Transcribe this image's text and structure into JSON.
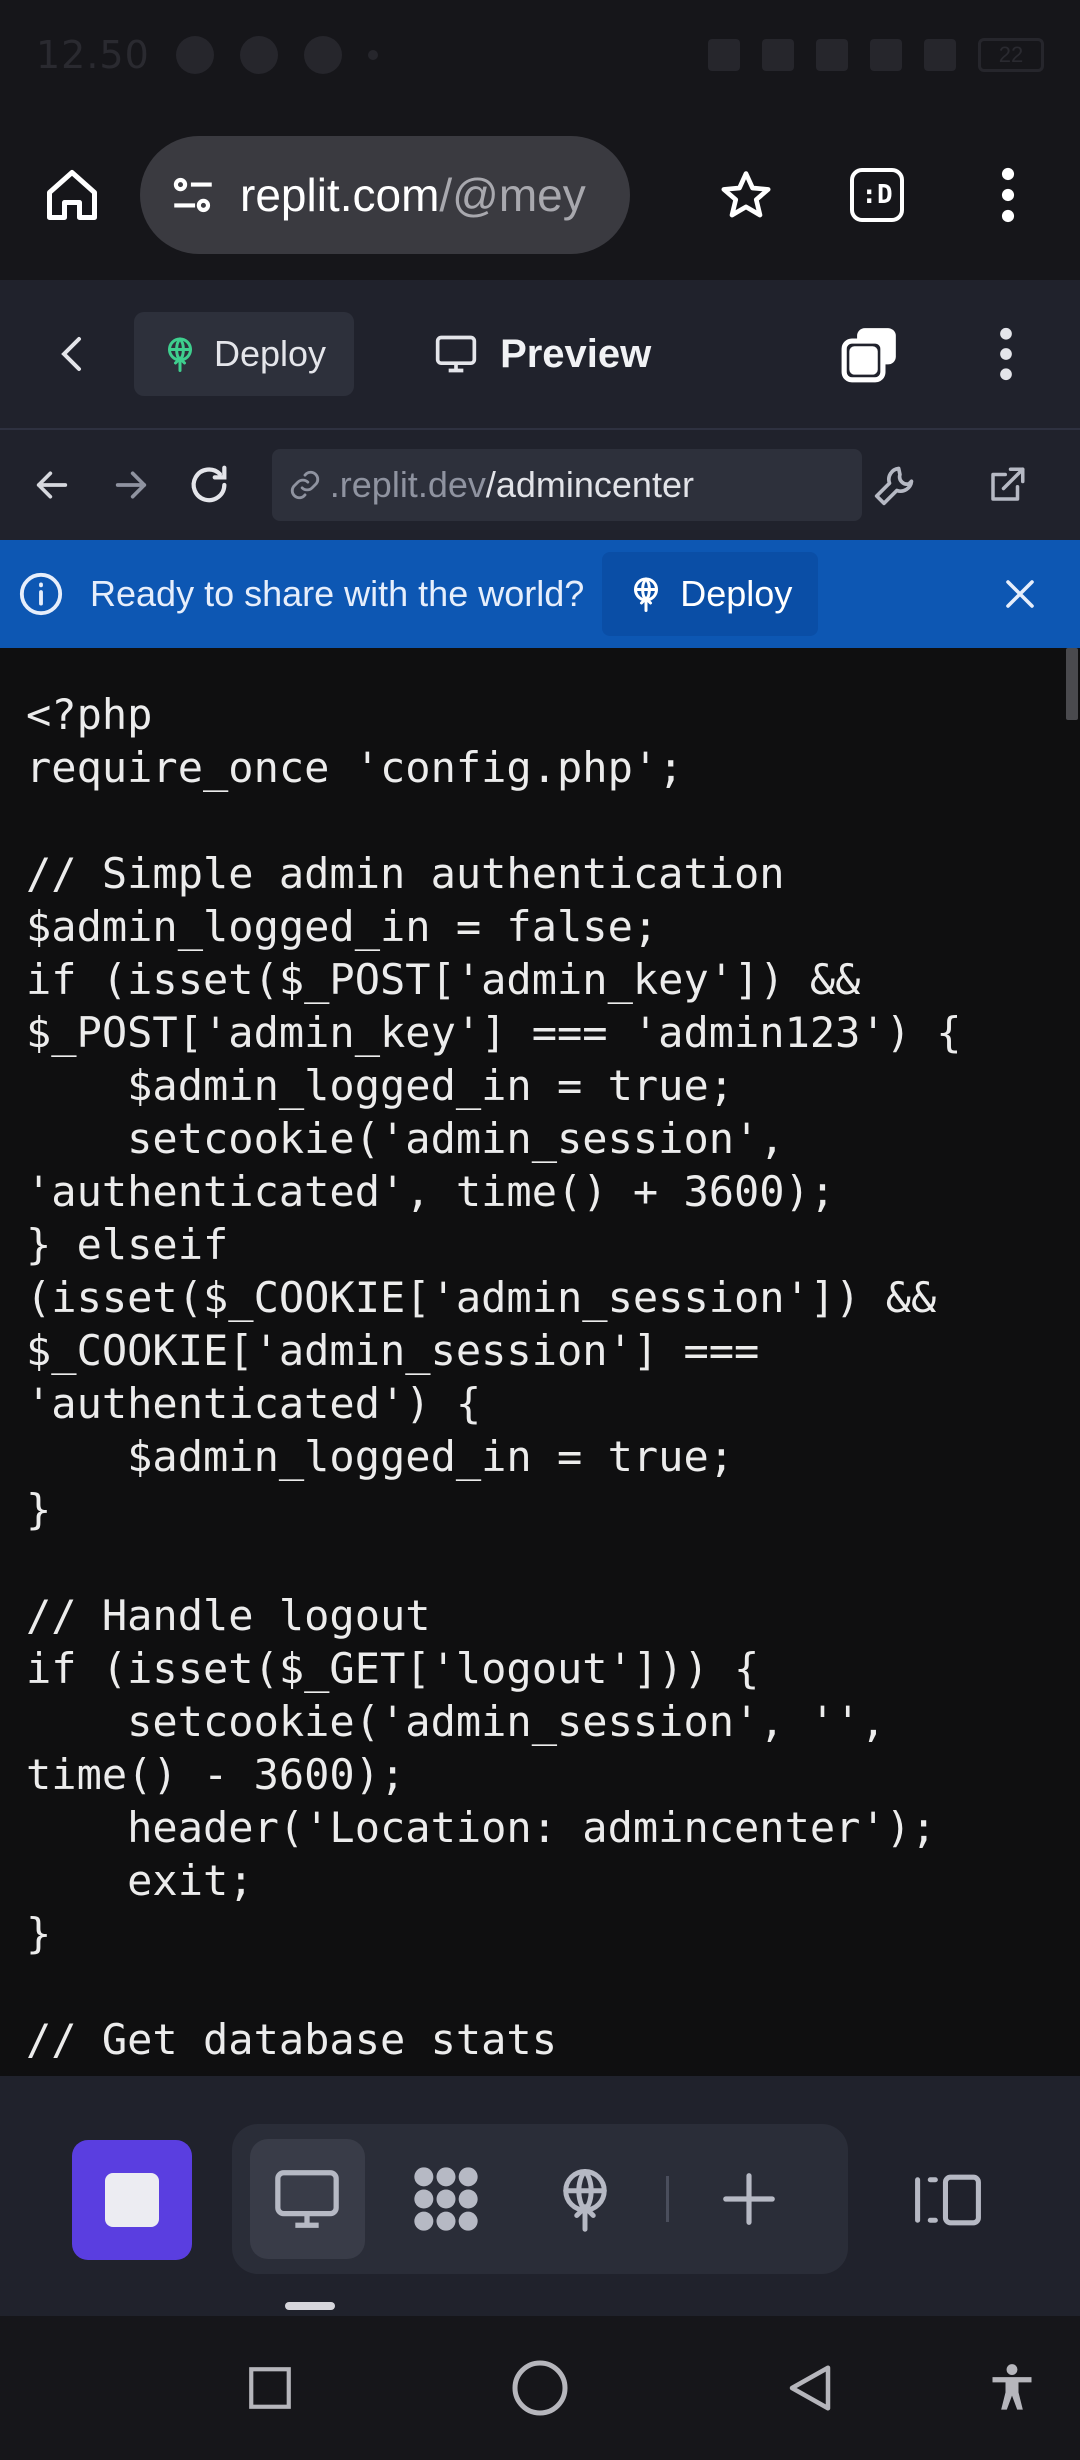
{
  "status_bar": {
    "time": "12.50",
    "battery": "22"
  },
  "browser": {
    "url_domain": "replit.com",
    "url_path": "/@mey",
    "tab_label": ":D"
  },
  "replit_toolbar": {
    "deploy_label": "Deploy",
    "preview_label": "Preview"
  },
  "webview": {
    "address_domain": ".replit.dev",
    "address_path": "/admincenter"
  },
  "banner": {
    "message": "Ready to share with the world?",
    "button_label": "Deploy"
  },
  "code": {
    "lines": [
      "<?php",
      "require_once 'config.php';",
      "",
      "// Simple admin authentication",
      "$admin_logged_in = false;",
      "if (isset($_POST['admin_key']) &&",
      "$_POST['admin_key'] === 'admin123') {",
      "    $admin_logged_in = true;",
      "    setcookie('admin_session',",
      "'authenticated', time() + 3600);",
      "} elseif",
      "(isset($_COOKIE['admin_session']) &&",
      "$_COOKIE['admin_session'] ===",
      "'authenticated') {",
      "    $admin_logged_in = true;",
      "}",
      "",
      "// Handle logout",
      "if (isset($_GET['logout'])) {",
      "    setcookie('admin_session', '',",
      "time() - 3600);",
      "    header('Location: admincenter');",
      "    exit;",
      "}",
      "",
      "// Get database stats"
    ]
  },
  "colors": {
    "accent_purple": "#5a3ee0",
    "banner_blue": "#0d57b3",
    "deploy_green": "#3ecf8e"
  },
  "icons": {
    "home": "home-icon",
    "site_settings": "tune-icon",
    "bookmark": "star-icon",
    "more": "kebab-icon",
    "back": "chevron-left-icon",
    "deploy": "globe-upload-icon",
    "preview": "monitor-icon",
    "stop": "stop-icon",
    "workspace": "apps-icon",
    "add": "plus-icon",
    "panel": "panel-icon"
  }
}
